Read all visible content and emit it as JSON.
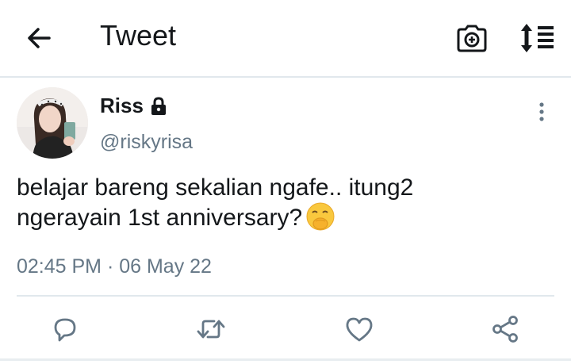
{
  "header": {
    "title": "Tweet",
    "back_icon": "back-arrow-icon",
    "camera_icon": "camera-add-icon",
    "sort_icon": "sort-icon"
  },
  "tweet": {
    "display_name": "Riss",
    "handle": "@riskyrisa",
    "protected": true,
    "lock_icon": "lock-icon",
    "text_line1": "belajar bareng sekalian ngafe.. itung2",
    "text_line2": "ngerayain 1st anniversary?",
    "emoji": "shushing-face-emoji",
    "timestamp": "02:45 PM · 06 May 22"
  },
  "actions": [
    {
      "name": "reply",
      "icon": "reply-icon"
    },
    {
      "name": "retweet",
      "icon": "retweet-icon"
    },
    {
      "name": "like",
      "icon": "heart-icon"
    },
    {
      "name": "share",
      "icon": "share-icon"
    }
  ],
  "colors": {
    "text": "#14171a",
    "secondary": "#657786",
    "divider": "#e1e8ed"
  }
}
